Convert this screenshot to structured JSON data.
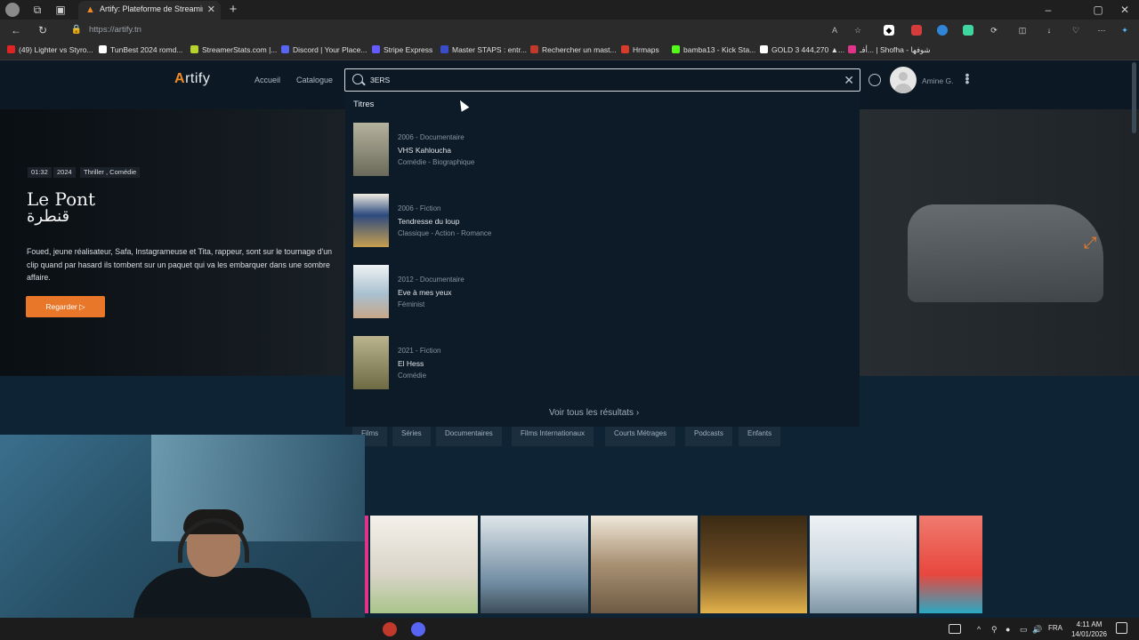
{
  "browser": {
    "tab_title": "Artify: Plateforme de Streaming V",
    "url": "https://artify.tn",
    "bookmarks": [
      {
        "label": "(49) Lighter vs Styro...",
        "color": "#e02424"
      },
      {
        "label": "TunBest 2024 romd...",
        "color": "#ffffff"
      },
      {
        "label": "StreamerStats.com |...",
        "color": "#b8d12e"
      },
      {
        "label": "Discord | Your Place...",
        "color": "#5865f2"
      },
      {
        "label": "Stripe Express",
        "color": "#635bff"
      },
      {
        "label": "Master STAPS : entr...",
        "color": "#3b4cca"
      },
      {
        "label": "Rechercher un mast...",
        "color": "#c0392b"
      },
      {
        "label": "Hrmaps",
        "color": "#d93b2b"
      },
      {
        "label": "bamba13 - Kick Sta...",
        "color": "#53fc18"
      },
      {
        "label": "GOLD 3 444,270 ▲...",
        "color": "#ffffff"
      },
      {
        "label": "أفـ... | Shofha - شوفها",
        "color": "#e0338a"
      }
    ]
  },
  "header": {
    "logo_prefix": "A",
    "logo_rest": "rtify",
    "nav": [
      "Accueil",
      "Catalogue"
    ],
    "search_value": "3ERS",
    "user_name": "Amine G."
  },
  "hero": {
    "duration": "01:32",
    "year": "2024",
    "genres": "Thriller , Comédie",
    "title_latin": "Le Pont",
    "title_arabic": "قنطرة",
    "description": "Foued, jeune réalisateur, Safa, Instagrameuse et Tita, rappeur, sont sur le tournage d'un clip quand par hasard ils tombent sur un paquet qui va les embarquer dans une sombre affaire.",
    "watch_label": "Regarder ▷"
  },
  "search_results": {
    "heading": "Titres",
    "items": [
      {
        "meta": "2006 - Documentaire",
        "title": "VHS Kahloucha",
        "genres": "Comédie - Biographique",
        "poster_color": "#8b8a7a"
      },
      {
        "meta": "2006 - Fiction",
        "title": "Tendresse du loup",
        "genres": "Classique - Action - Romance",
        "poster_color": "#3f5a8a"
      },
      {
        "meta": "2012 - Documentaire",
        "title": "Eve à mes yeux",
        "genres": "Féminist",
        "poster_color": "#9fb4c3"
      },
      {
        "meta": "2021 - Fiction",
        "title": "El Hess",
        "genres": "Comédie",
        "poster_color": "#8a8a5e"
      }
    ],
    "see_all": "Voir tous les résultats ›"
  },
  "categories": [
    "Films",
    "Séries",
    "Documentaires",
    "Films Internationaux",
    "Courts Métrages",
    "Podcasts",
    "Enfants"
  ],
  "poster_row": [
    {
      "color": "#d9d4c8",
      "accent": "#7bc043"
    },
    {
      "color": "#6f8aa0",
      "accent": "#dfe6ea"
    },
    {
      "color": "#a89072",
      "accent": "#efe8da"
    },
    {
      "color": "#6a4a22",
      "accent": "#e3b24a"
    },
    {
      "color": "#c9d6df",
      "accent": "#f1c232"
    },
    {
      "color": "#e8473e",
      "accent": "#2aa9c4"
    }
  ],
  "taskbar": {
    "lang": "FRA",
    "time": "4:11 AM",
    "date": "14/01/2026"
  }
}
